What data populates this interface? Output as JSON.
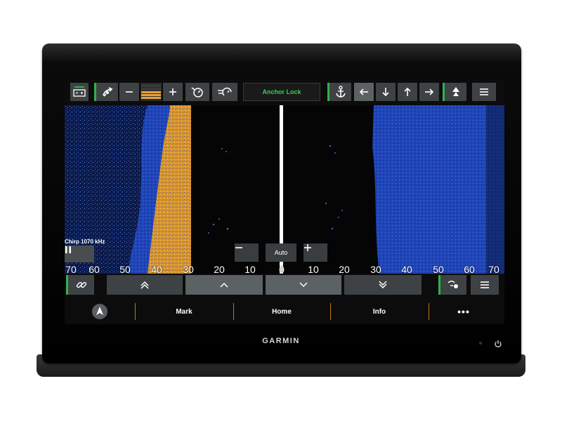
{
  "brand": "GARMIN",
  "toolbar": {
    "anchor_lock": "Anchor Lock"
  },
  "sonar": {
    "frequency": "Chirp 1070 kHz",
    "gain_mode": "Auto",
    "range_labels": [
      "70",
      "60",
      "50",
      "40",
      "30",
      "20",
      "10",
      "0",
      "10",
      "20",
      "30",
      "40",
      "50",
      "60",
      "70"
    ]
  },
  "softkeys": {
    "mark": "Mark",
    "home": "Home",
    "info": "Info",
    "more": "•••"
  },
  "colors": {
    "accent_green": "#2fb24c",
    "softkey_divider": "#c07a1a",
    "anchor_text": "#38d14a",
    "sonar_blue": "#2f56c9",
    "sonar_gold": "#e6a43a"
  }
}
